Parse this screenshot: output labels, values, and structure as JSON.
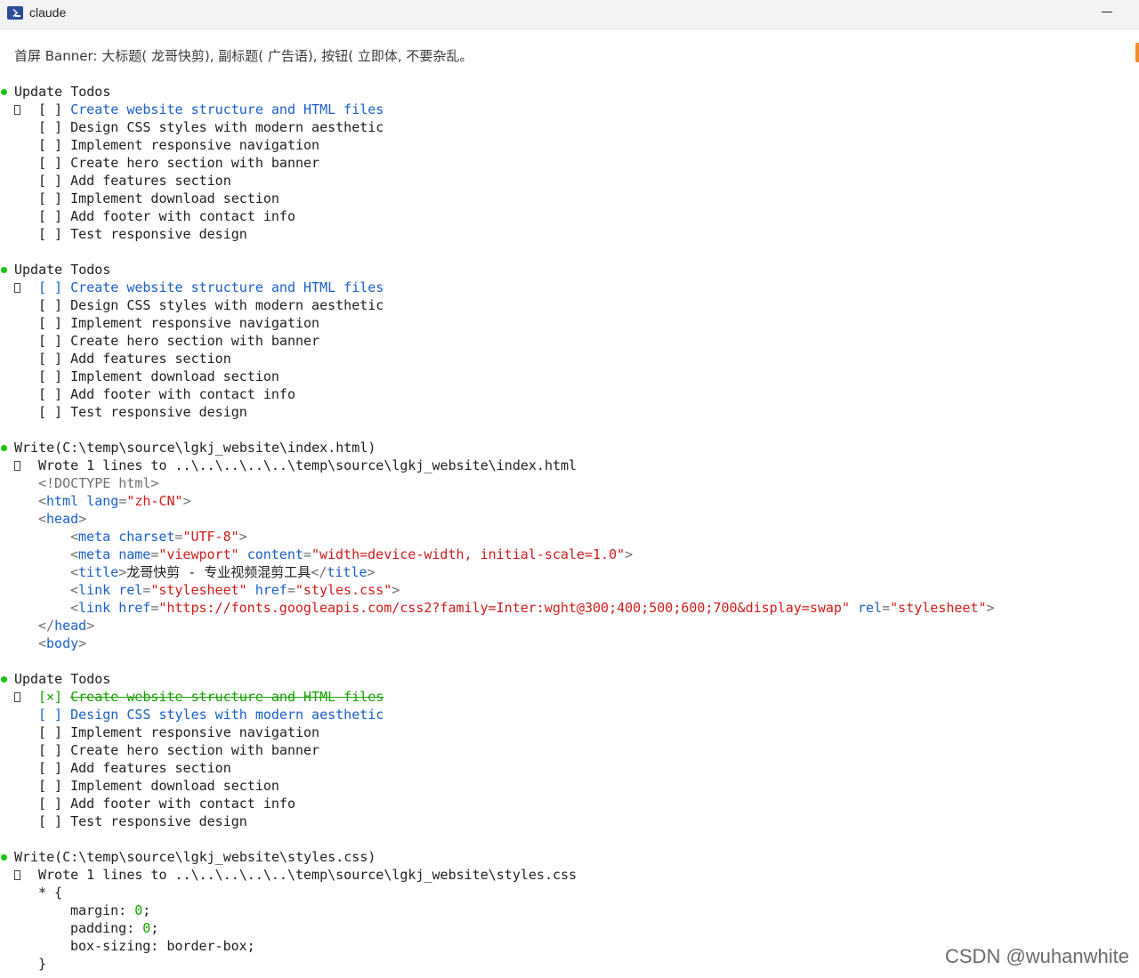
{
  "window": {
    "title": "claude"
  },
  "prompt": "首屏 Banner: 大标题( 龙哥快剪), 副标题( 广告语), 按钮( 立即体, 不要杂乱。",
  "todo_blocks": [
    {
      "header": "Update Todos",
      "items": [
        {
          "mark": "[ ]",
          "text": "Create website structure and HTML files"
        },
        {
          "mark": "[ ]",
          "text": "Design CSS styles with modern aesthetic"
        },
        {
          "mark": "[ ]",
          "text": "Implement responsive navigation"
        },
        {
          "mark": "[ ]",
          "text": "Create hero section with banner"
        },
        {
          "mark": "[ ]",
          "text": "Add features section"
        },
        {
          "mark": "[ ]",
          "text": "Implement download section"
        },
        {
          "mark": "[ ]",
          "text": "Add footer with contact info"
        },
        {
          "mark": "[ ]",
          "text": "Test responsive design"
        }
      ]
    },
    {
      "header": "Update Todos",
      "items": [
        {
          "mark": "[ ]",
          "text": "Create website structure and HTML files"
        },
        {
          "mark": "[ ]",
          "text": "Design CSS styles with modern aesthetic"
        },
        {
          "mark": "[ ]",
          "text": "Implement responsive navigation"
        },
        {
          "mark": "[ ]",
          "text": "Create hero section with banner"
        },
        {
          "mark": "[ ]",
          "text": "Add features section"
        },
        {
          "mark": "[ ]",
          "text": "Implement download section"
        },
        {
          "mark": "[ ]",
          "text": "Add footer with contact info"
        },
        {
          "mark": "[ ]",
          "text": "Test responsive design"
        }
      ]
    },
    {
      "header": "Update Todos",
      "items": [
        {
          "mark": "[×]",
          "text": "Create website structure and HTML files",
          "done": true
        },
        {
          "mark": "[ ]",
          "text": "Design CSS styles with modern aesthetic"
        },
        {
          "mark": "[ ]",
          "text": "Implement responsive navigation"
        },
        {
          "mark": "[ ]",
          "text": "Create hero section with banner"
        },
        {
          "mark": "[ ]",
          "text": "Add features section"
        },
        {
          "mark": "[ ]",
          "text": "Implement download section"
        },
        {
          "mark": "[ ]",
          "text": "Add footer with contact info"
        },
        {
          "mark": "[ ]",
          "text": "Test responsive design"
        }
      ]
    }
  ],
  "write_html": {
    "header_name": "Write",
    "header_path": "(C:\\temp\\source\\lgkj_website\\index.html)",
    "result": "Wrote 1 lines to ..\\..\\..\\..\\..\\temp\\source\\lgkj_website\\index.html",
    "code": {
      "doctype": "<!DOCTYPE html>",
      "html_tag": "html",
      "lang_attr": "lang",
      "lang_val": "\"zh-CN\"",
      "head_tag": "head",
      "meta_tag": "meta",
      "charset_attr": "charset",
      "charset_val": "\"UTF-8\"",
      "name_attr": "name",
      "name_val": "\"viewport\"",
      "content_attr": "content",
      "content_val": "\"width=device-width, initial-scale=1.0\"",
      "title_tag": "title",
      "title_text": "龙哥快剪 - 专业视频混剪工具",
      "link_tag": "link",
      "rel_attr": "rel",
      "rel_val": "\"stylesheet\"",
      "href_attr": "href",
      "href_css_val": "\"styles.css\"",
      "href_font_val": "\"https://fonts.googleapis.com/css2?family=Inter:wght@300;400;500;600;700&display=swap\"",
      "body_tag": "body"
    }
  },
  "write_css": {
    "header_name": "Write",
    "header_path": "(C:\\temp\\source\\lgkj_website\\styles.css)",
    "result": "Wrote 1 lines to ..\\..\\..\\..\\..\\temp\\source\\lgkj_website\\styles.css",
    "code": {
      "selector": "* {",
      "margin_prop": "margin: ",
      "margin_val": "0",
      "padding_prop": "padding: ",
      "padding_val": "0",
      "box_sizing": "box-sizing: border-box;",
      "semicolon": ";",
      "close": "}"
    }
  },
  "watermark": "CSDN @wuhanwhite",
  "colors": {
    "dot": "#16c60c",
    "done": "#16a000",
    "tag": "#1a5fc8",
    "string": "#d01b1b"
  }
}
